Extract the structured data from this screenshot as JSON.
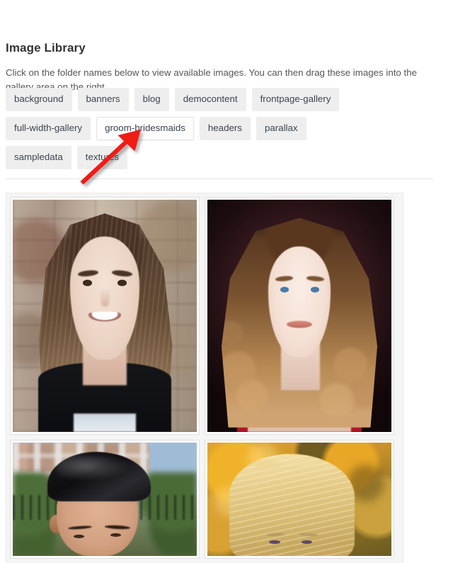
{
  "panel": {
    "title": "Image Library",
    "description": "Click on the folder names below to view available images. You can then drag these images into the gallery area on the right."
  },
  "folders": {
    "rows": [
      [
        {
          "label": "background",
          "active": false
        },
        {
          "label": "banners",
          "active": false
        },
        {
          "label": "blog",
          "active": false
        },
        {
          "label": "democontent",
          "active": false
        },
        {
          "label": "frontpage-gallery",
          "active": false
        }
      ],
      [
        {
          "label": "full-width-gallery",
          "active": false
        },
        {
          "label": "groom-bridesmaids",
          "active": true
        },
        {
          "label": "headers",
          "active": false
        },
        {
          "label": "parallax",
          "active": false
        }
      ],
      [
        {
          "label": "sampledata",
          "active": false
        },
        {
          "label": "textures",
          "active": false
        }
      ]
    ]
  },
  "gallery": {
    "items": [
      {
        "alt": "Smiling young woman with long brown hair in black t-shirt against brick wall"
      },
      {
        "alt": "Young woman with long curled hair in red dress on dark burgundy background"
      },
      {
        "alt": "Young man with dark styled hair in front of city apartment buildings"
      },
      {
        "alt": "Blonde young woman with wavy hair against golden autumn foliage"
      }
    ]
  },
  "annotation": {
    "arrow_color": "#ef1b14",
    "points_to": "groom-bridesmaids"
  },
  "colors": {
    "tag_background": "#eeeeee",
    "tag_active_background": "#fdfdfd",
    "gallery_background": "#f5f5f5",
    "text_primary": "#333333",
    "text_body": "#555555",
    "divider": "#e6e6e6"
  }
}
